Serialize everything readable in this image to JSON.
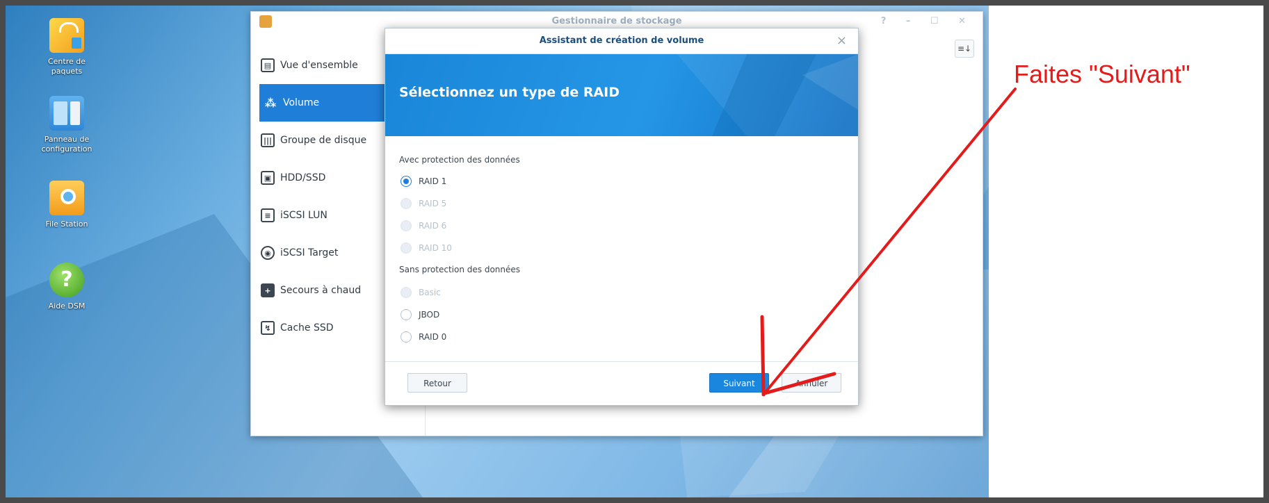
{
  "desktop": {
    "icons": [
      {
        "label": "Centre de paquets",
        "icon": "shopping-bag-icon"
      },
      {
        "label": "Panneau de configuration",
        "icon": "control-panel-icon"
      },
      {
        "label": "File Station",
        "icon": "folder-search-icon"
      },
      {
        "label": "Aide DSM",
        "icon": "help-icon"
      }
    ]
  },
  "window": {
    "title": "Gestionnaire de stockage",
    "controls": "? – ☐ ✕",
    "sort_icon": "≡↓",
    "sidebar": [
      {
        "label": "Vue d'ensemble",
        "icon": "overview-icon",
        "glyph": "▤"
      },
      {
        "label": "Volume",
        "icon": "volume-icon",
        "glyph": "⁂"
      },
      {
        "label": "Groupe de disque",
        "icon": "disk-group-icon",
        "glyph": "|||"
      },
      {
        "label": "HDD/SSD",
        "icon": "hdd-icon",
        "glyph": "▣"
      },
      {
        "label": "iSCSI LUN",
        "icon": "iscsi-lun-icon",
        "glyph": "≡"
      },
      {
        "label": "iSCSI Target",
        "icon": "iscsi-target-icon",
        "glyph": "◉"
      },
      {
        "label": "Secours à chaud",
        "icon": "hot-spare-icon",
        "glyph": "+"
      },
      {
        "label": "Cache SSD",
        "icon": "ssd-cache-icon",
        "glyph": "↯"
      }
    ],
    "active_item": "Volume"
  },
  "dialog": {
    "title": "Assistant de création de volume",
    "close": "×",
    "banner_title": "Sélectionnez un type de RAID",
    "section_protected": "Avec protection des données",
    "section_unprotected": "Sans protection des données",
    "options_protected": [
      {
        "label": "RAID 1",
        "checked": true,
        "disabled": false
      },
      {
        "label": "RAID 5",
        "checked": false,
        "disabled": true
      },
      {
        "label": "RAID 6",
        "checked": false,
        "disabled": true
      },
      {
        "label": "RAID 10",
        "checked": false,
        "disabled": true
      }
    ],
    "options_unprotected": [
      {
        "label": "Basic",
        "checked": false,
        "disabled": true
      },
      {
        "label": "JBOD",
        "checked": false,
        "disabled": false
      },
      {
        "label": "RAID 0",
        "checked": false,
        "disabled": false
      }
    ],
    "buttons": {
      "back": "Retour",
      "next": "Suivant",
      "cancel": "Annuler"
    }
  },
  "annotation": {
    "text": "Faites \"Suivant\"",
    "color": "#e31b1b"
  }
}
